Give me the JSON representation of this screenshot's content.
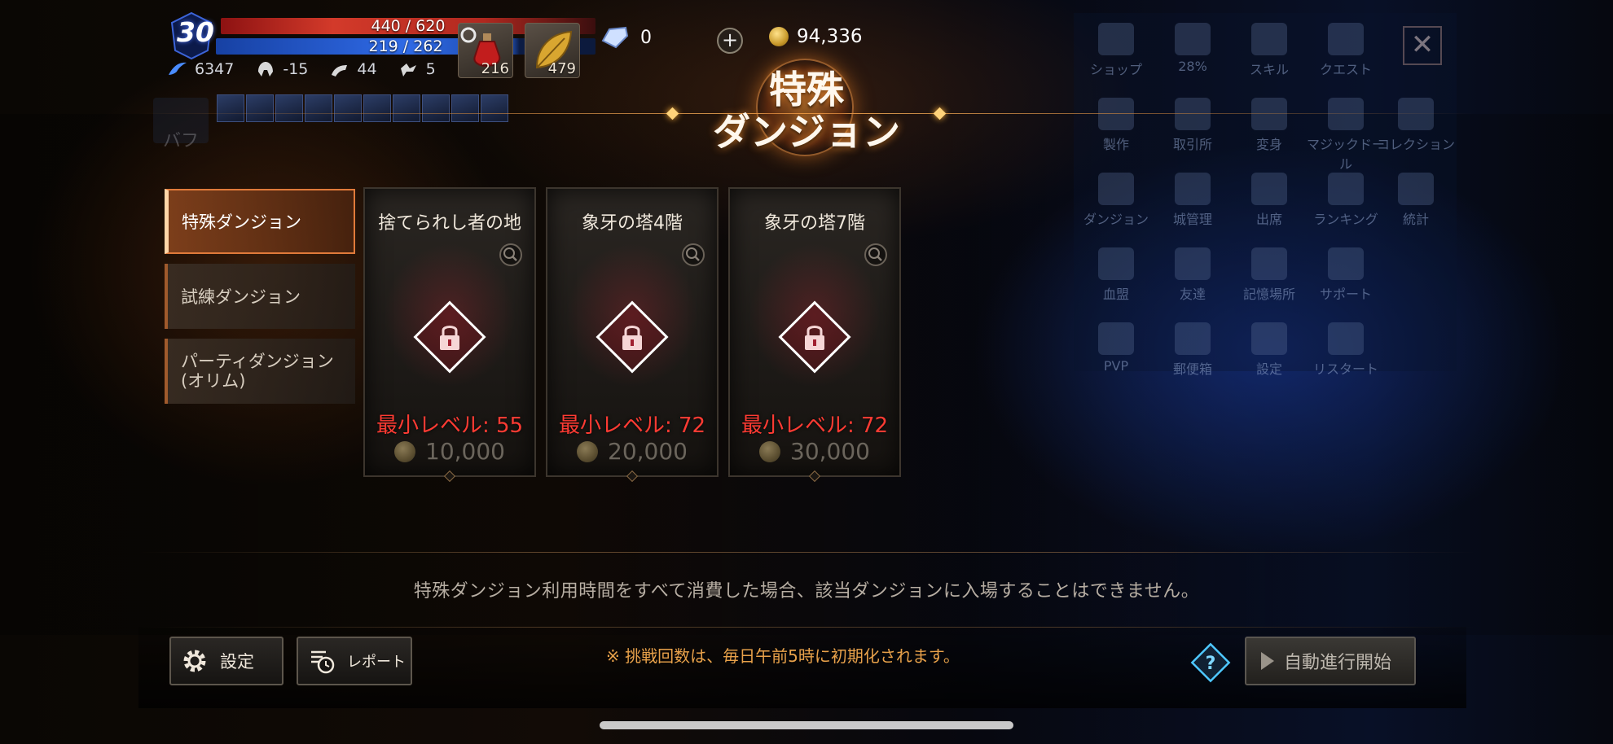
{
  "hud": {
    "level": "30",
    "hp_text": "440 / 620",
    "mp_text": "219 / 262",
    "stats": [
      "6347",
      "-15",
      "44",
      "5"
    ],
    "items": [
      {
        "icon": "potion-icon",
        "count": "216"
      },
      {
        "icon": "leaf-icon",
        "count": "479"
      }
    ],
    "crystal_count": "0",
    "gold": "94,336"
  },
  "title": {
    "line1": "特殊",
    "line2": "ダンジョン"
  },
  "tabs": [
    {
      "label": "特殊ダンジョン",
      "active": true
    },
    {
      "label": "試練ダンジョン",
      "active": false
    },
    {
      "label_line1": "パーティダンジョン",
      "label_line2": "(オリム)",
      "active": false
    }
  ],
  "dungeons": [
    {
      "name": "捨てられし者の地",
      "min_level_label": "最小レベル: 55",
      "cost": "10,000"
    },
    {
      "name": "象牙の塔4階",
      "min_level_label": "最小レベル: 72",
      "cost": "20,000"
    },
    {
      "name": "象牙の塔7階",
      "min_level_label": "最小レベル: 72",
      "cost": "30,000"
    }
  ],
  "notice": "特殊ダンジョン利用時間をすべて消費した場合、該当ダンジョンに入場することはできません。",
  "reset_notice": "※ 挑戦回数は、毎日午前5時に初期化されます。",
  "buttons": {
    "settings": "設定",
    "report": "レポート",
    "auto": "自動進行開始"
  },
  "background_menu": {
    "items": [
      "ショップ",
      "28%",
      "スキル",
      "クエスト",
      "製作",
      "取引所",
      "変身",
      "マジックドール",
      "コレクション",
      "ダンジョン",
      "城管理",
      "出席",
      "ランキング",
      "統計",
      "血盟",
      "友達",
      "記憶場所",
      "サポート",
      "PVP",
      "郵便箱",
      "設定",
      "リスタート"
    ]
  },
  "buff_panel": {
    "label": "バフ"
  },
  "colors": {
    "accent_orange": "#e07a3a",
    "locked_red": "#ff3b33",
    "notice_orange": "#e8a14a"
  }
}
